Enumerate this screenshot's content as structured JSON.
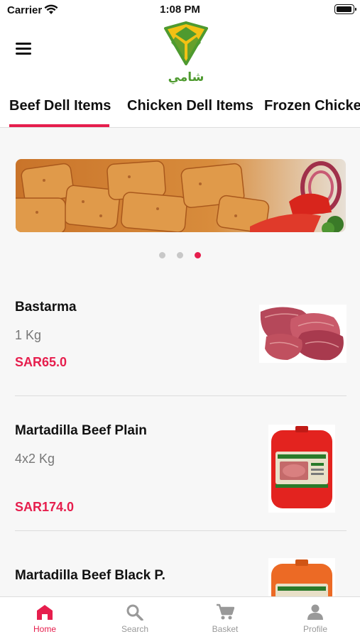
{
  "status_bar": {
    "carrier": "Carrier",
    "time": "1:08 PM"
  },
  "header": {
    "logo_text": "شامي"
  },
  "tabs": [
    {
      "label": "Beef Dell Items"
    },
    {
      "label": "Chicken Dell Items"
    },
    {
      "label": "Frozen Chicken"
    }
  ],
  "banner": {
    "slides": 3,
    "active_slide": 3
  },
  "products": [
    {
      "name": "Bastarma",
      "unit": "1 Kg",
      "price": "SAR65.0"
    },
    {
      "name": "Martadilla Beef Plain",
      "unit": "4x2 Kg",
      "price": "SAR174.0"
    },
    {
      "name": "Martadilla Beef Black P.",
      "unit": "",
      "price": ""
    }
  ],
  "bottom_nav": [
    {
      "label": "Home",
      "icon": "home-icon",
      "active": true
    },
    {
      "label": "Search",
      "icon": "search-icon",
      "active": false
    },
    {
      "label": "Basket",
      "icon": "cart-icon",
      "active": false
    },
    {
      "label": "Profile",
      "icon": "person-icon",
      "active": false
    }
  ],
  "colors": {
    "accent": "#e61e4d",
    "logo_yellow": "#f2c114",
    "logo_green": "#4e9a2f"
  }
}
